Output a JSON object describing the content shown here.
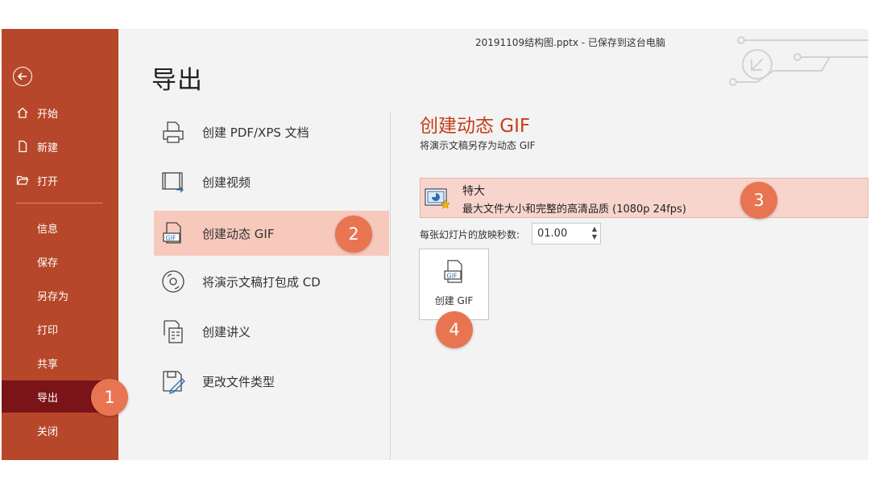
{
  "window": {
    "file_title": "20191109结构图.pptx  -  已保存到这台电脑"
  },
  "sidebar": {
    "back_icon": "back-arrow-icon",
    "items": [
      {
        "label": "开始",
        "icon": "home-icon"
      },
      {
        "label": "新建",
        "icon": "new-document-icon"
      },
      {
        "label": "打开",
        "icon": "folder-open-icon"
      },
      {
        "label": "信息"
      },
      {
        "label": "保存"
      },
      {
        "label": "另存为"
      },
      {
        "label": "打印"
      },
      {
        "label": "共享"
      },
      {
        "label": "导出",
        "active": true
      },
      {
        "label": "关闭"
      }
    ]
  },
  "page": {
    "title": "导出"
  },
  "export_options": [
    {
      "label": "创建 PDF/XPS 文档",
      "icon": "pdf-printer-icon"
    },
    {
      "label": "创建视频",
      "icon": "video-film-icon"
    },
    {
      "label": "创建动态 GIF",
      "icon": "gif-file-icon",
      "active": true
    },
    {
      "label": "将演示文稿打包成 CD",
      "icon": "cd-disc-icon"
    },
    {
      "label": "创建讲义",
      "icon": "handout-icon"
    },
    {
      "label": "更改文件类型",
      "icon": "change-file-type-icon"
    }
  ],
  "gif_panel": {
    "title": "创建动态 GIF",
    "description": "将演示文稿另存为动态 GIF",
    "quality": {
      "name": "特大",
      "detail": "最大文件大小和完整的高清品质 (1080p 24fps)",
      "icon": "quality-star-icon"
    },
    "seconds_label": "每张幻灯片的放映秒数:",
    "seconds_value": "01.00",
    "create_button_label": "创建 GIF"
  },
  "badges": [
    "1",
    "2",
    "3",
    "4"
  ],
  "colors": {
    "sidebar": "#b7472a",
    "sidebar_active": "#7b1418",
    "accent": "#c43e1c",
    "highlight": "#f7c9bc",
    "badge": "#e97451"
  }
}
